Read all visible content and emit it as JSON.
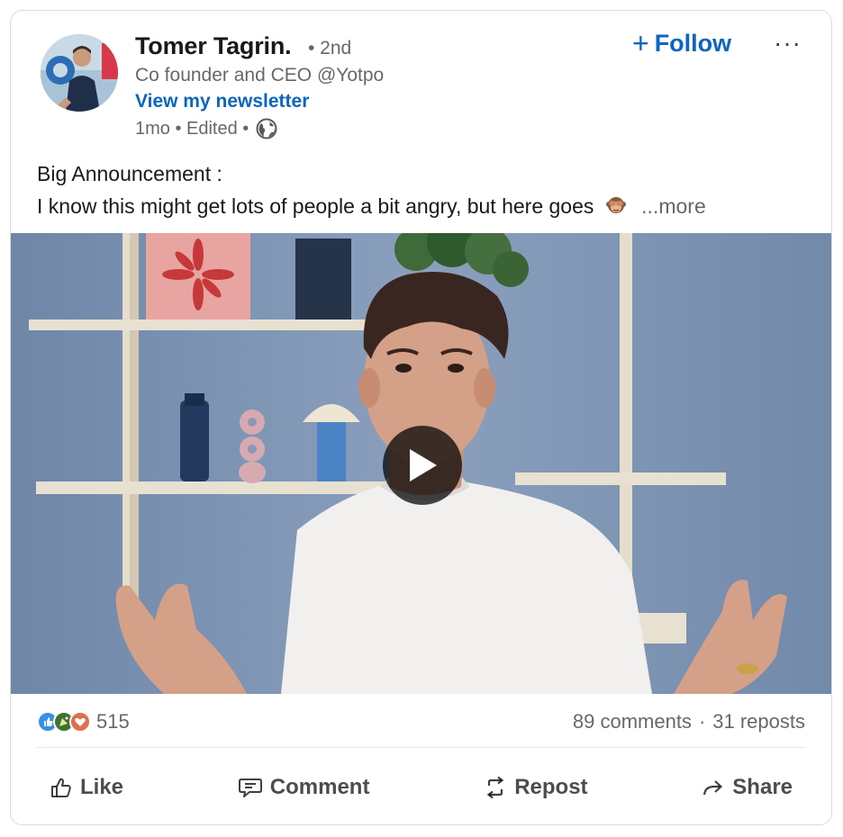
{
  "author": {
    "name": "Tomer Tagrin.",
    "degree": "• 2nd",
    "headline": "Co founder and CEO @Yotpo",
    "newsletter_link": "View my newsletter",
    "meta": "1mo • Edited •",
    "avatar_icon": "profile-photo"
  },
  "header_actions": {
    "follow_plus": "+",
    "follow_label": "Follow",
    "more_menu": "···"
  },
  "post": {
    "line1": "Big Announcement :",
    "line2": "I know this might get lots of people a bit angry, but here goes",
    "emoji": "see-no-evil-monkey",
    "see_more": "...more"
  },
  "video": {
    "play_icon": "play-icon"
  },
  "social": {
    "reaction_count": "515",
    "comments": "89 comments",
    "separator": "·",
    "reposts": "31 reposts",
    "reaction_icons": [
      "like-reaction-icon",
      "celebrate-reaction-icon",
      "love-reaction-icon"
    ]
  },
  "actions": {
    "like": "Like",
    "comment": "Comment",
    "repost": "Repost",
    "share": "Share"
  },
  "colors": {
    "brand_blue": "#0a66c2",
    "text_primary": "rgba(0,0,0,0.9)",
    "text_secondary": "rgba(0,0,0,0.6)"
  }
}
